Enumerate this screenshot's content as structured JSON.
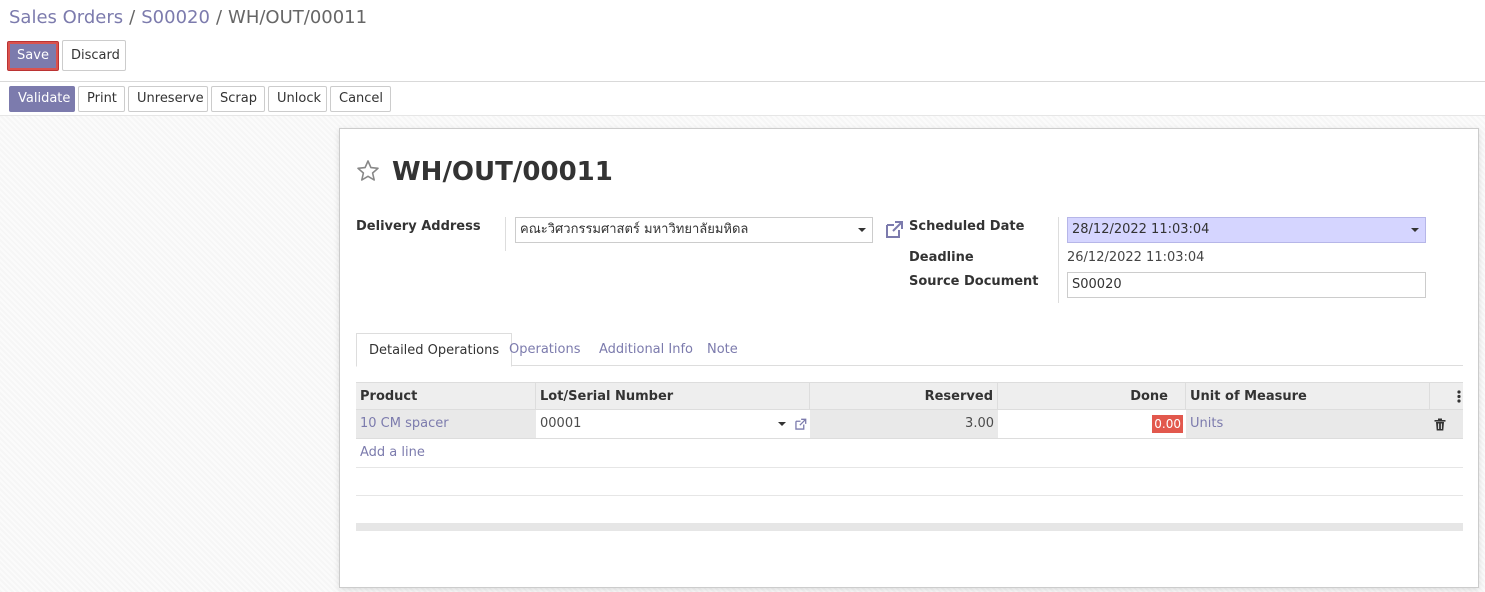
{
  "breadcrumb": {
    "items": [
      "Sales Orders",
      "S00020"
    ],
    "current": "WH/OUT/00011",
    "separator": "/"
  },
  "control": {
    "save_label": "Save",
    "discard_label": "Discard"
  },
  "status_buttons": {
    "validate": "Validate",
    "print": "Print",
    "unreserve": "Unreserve",
    "scrap": "Scrap",
    "unlock": "Unlock",
    "cancel": "Cancel"
  },
  "form": {
    "title": "WH/OUT/00011",
    "delivery_address_label": "Delivery Address",
    "delivery_address_value": "คณะวิศวกรรมศาสตร์ มหาวิทยาลัยมหิดล",
    "scheduled_date_label": "Scheduled Date",
    "scheduled_date_value": "28/12/2022 11:03:04",
    "deadline_label": "Deadline",
    "deadline_value": "26/12/2022 11:03:04",
    "source_document_label": "Source Document",
    "source_document_value": "S00020"
  },
  "tabs": [
    "Detailed Operations",
    "Operations",
    "Additional Info",
    "Note"
  ],
  "table": {
    "columns": [
      "Product",
      "Lot/Serial Number",
      "Reserved",
      "Done",
      "Unit of Measure"
    ],
    "rows": [
      {
        "product": "10 CM spacer",
        "lot": "00001",
        "reserved": "3.00",
        "done": "0.00",
        "uom": "Units"
      }
    ],
    "add_line": "Add a line"
  },
  "colors": {
    "brand": "#7c7bad",
    "done_highlight": "#e2584d",
    "date_field_bg": "#d5d5ff"
  },
  "icons": [
    "star-icon",
    "external-link-icon",
    "caret-down-icon",
    "kebab-icon",
    "trash-icon"
  ]
}
